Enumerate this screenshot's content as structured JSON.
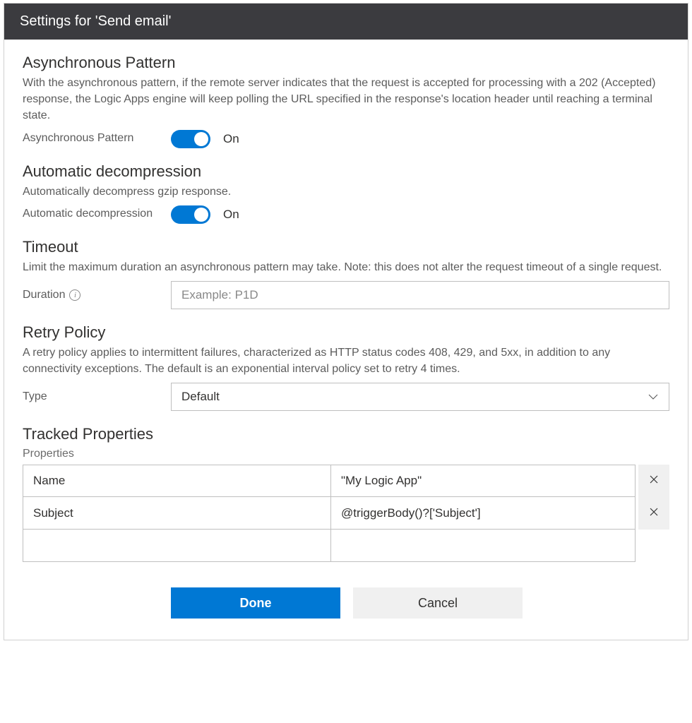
{
  "titlebar": "Settings for 'Send email'",
  "async": {
    "title": "Asynchronous Pattern",
    "desc": "With the asynchronous pattern, if the remote server indicates that the request is accepted for processing with a 202 (Accepted) response, the Logic Apps engine will keep polling the URL specified in the response's location header until reaching a terminal state.",
    "label": "Asynchronous Pattern",
    "state": "On"
  },
  "decomp": {
    "title": "Automatic decompression",
    "desc": "Automatically decompress gzip response.",
    "label": "Automatic decompression",
    "state": "On"
  },
  "timeout": {
    "title": "Timeout",
    "desc": "Limit the maximum duration an asynchronous pattern may take. Note: this does not alter the request timeout of a single request.",
    "label": "Duration",
    "placeholder": "Example: P1D",
    "value": ""
  },
  "retry": {
    "title": "Retry Policy",
    "desc": "A retry policy applies to intermittent failures, characterized as HTTP status codes 408, 429, and 5xx, in addition to any connectivity exceptions. The default is an exponential interval policy set to retry 4 times.",
    "label": "Type",
    "selected": "Default"
  },
  "tracked": {
    "title": "Tracked Properties",
    "sublabel": "Properties",
    "rows": [
      {
        "name": "Name",
        "value": "\"My Logic App\""
      },
      {
        "name": "Subject",
        "value": "@triggerBody()?['Subject']"
      }
    ]
  },
  "buttons": {
    "done": "Done",
    "cancel": "Cancel"
  }
}
